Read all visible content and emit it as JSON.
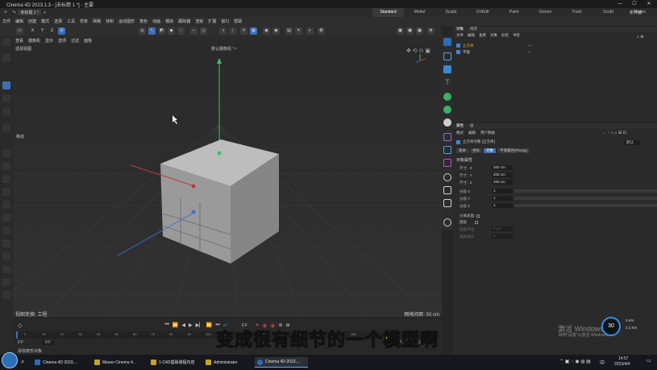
{
  "window": {
    "title": "Cinema 4D 2023.1.3 - [未标题 1 *] - 主要",
    "minimize_icon": "—",
    "maximize_icon": "☐",
    "close_icon": "✕"
  },
  "menubar": {
    "items": [
      "文件",
      "编辑",
      "创建",
      "模式",
      "选择",
      "工具",
      "样条",
      "网格",
      "体积",
      "运动图形",
      "角色",
      "动画",
      "模拟",
      "跟踪器",
      "渲染",
      "扩展",
      "窗口",
      "帮助"
    ],
    "doc_tab": "未标题 1 *"
  },
  "layouts": {
    "items": [
      "Standard",
      "Model",
      "Sculpt",
      "UVEdit",
      "Paint",
      "Groom",
      "Track",
      "Script",
      "Nodes"
    ],
    "active": "Standard",
    "new_layout": "新界面"
  },
  "coord_toolbar": {
    "x": "X",
    "y": "Y",
    "z": "Z"
  },
  "viewport": {
    "menu": [
      "查看",
      "摄像机",
      "显示",
      "选项",
      "过滤",
      "面板"
    ],
    "view_label": "透视视图",
    "camera_label": "默认摄像机 °✓",
    "move_label": "移动",
    "foot_left": "视图变换: 工程",
    "foot_right": "网格间距: 50 cm"
  },
  "timeline": {
    "ticks": [
      "0",
      "10",
      "20",
      "30",
      "40",
      "50",
      "60",
      "70",
      "80",
      "90",
      "100",
      "110",
      "120",
      "130",
      "140",
      "150",
      "160",
      "170",
      "180",
      "190",
      "200",
      "210",
      "220"
    ],
    "frame_start": "0 F",
    "frame_field": "0 F",
    "frame_current": "0 F",
    "frame_end": "230 F",
    "end_field": "230 F",
    "footer": "添加变形对象"
  },
  "objects": {
    "tabs": [
      "对象",
      "场次"
    ],
    "menu": [
      "文件",
      "编辑",
      "查看",
      "对象",
      "标签",
      "书签"
    ],
    "rows": [
      {
        "name": "立方体",
        "color": "#e8a23a"
      },
      {
        "name": "平面",
        "color": "#bbbbbb"
      }
    ]
  },
  "attributes": {
    "tabs": [
      "属性",
      "层"
    ],
    "menu": [
      "模式",
      "编辑",
      "用户数据"
    ],
    "object_title": "立方体对象 [立方体]",
    "preset": "默认",
    "subtabs": [
      "基本",
      "坐标",
      "对象",
      "平滑着色(Phong)"
    ],
    "active_subtab": "对象",
    "section": "对象属性",
    "fields": [
      {
        "label": "尺寸 . X",
        "value": "200 cm"
      },
      {
        "label": "尺寸 . Y",
        "value": "200 cm"
      },
      {
        "label": "尺寸 . Z",
        "value": "200 cm"
      },
      {
        "label": "分段 X",
        "value": "1"
      },
      {
        "label": "分段 Y",
        "value": "1"
      },
      {
        "label": "分段 Z",
        "value": "1"
      }
    ],
    "separate_label": "分离表面",
    "fillet_label": "圆角",
    "fillet_radius_label": "圆角半径",
    "fillet_radius_value": "5 cm",
    "fillet_sub_label": "圆角细分",
    "fillet_sub_value": "5"
  },
  "subtitle": "变成很有细节的一个模型啊",
  "watermark": {
    "line1": "激活 Windows",
    "line2": "转到\"设置\"以激活 Windows。"
  },
  "taskbar": {
    "items": [
      "Cinema 4D 2023....",
      "Maxon Cinema 4...",
      "1-C4D基础课程内容",
      "Administrator",
      "Cinema 4D 2023...."
    ],
    "time": "14:57",
    "date": "2023/4/4",
    "lang": "中",
    "net_percent": "30",
    "net_up": "0 K/s",
    "net_down": "2.1 K/s"
  }
}
